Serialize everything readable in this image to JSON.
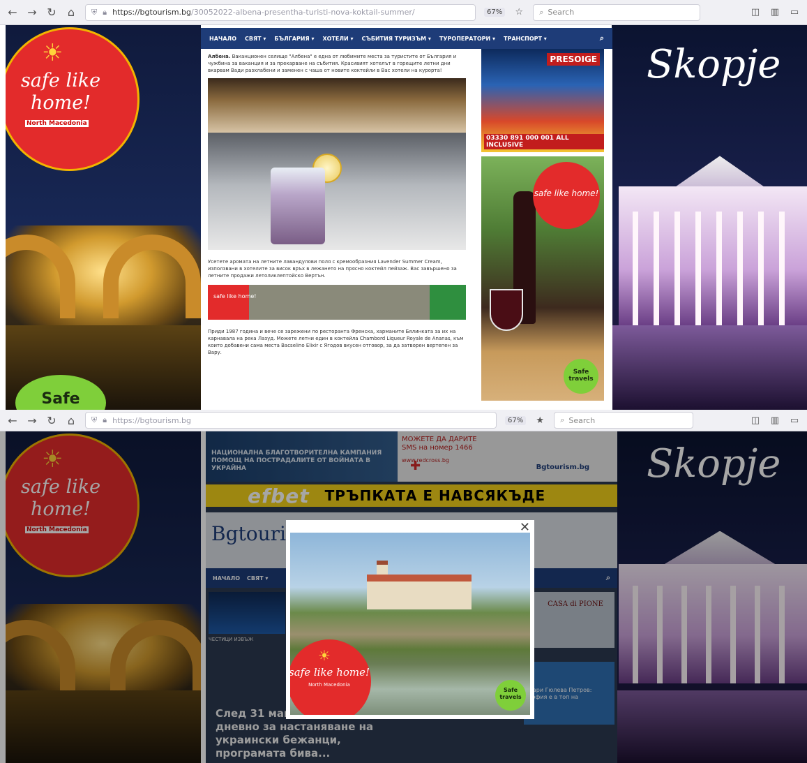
{
  "screenshot_top": {
    "browser": {
      "back": "←",
      "forward": "→",
      "reload": "↻",
      "home": "⌂",
      "url_host": "https://bgtourism.bg",
      "url_path": "/30052022-albena-presentha-turisti-nova-koktail-summer/",
      "zoom": "67%",
      "search_placeholder": "Search"
    },
    "nav": [
      "НАЧАЛО",
      "СВЯТ ▾",
      "БЪЛГАРИЯ ▾",
      "ХОТЕЛИ ▾",
      "СЪБИТИЯ ТУРИЗЪМ ▾",
      "ТУРОПЕРАТОРИ ▾",
      "ТРАНСПОРТ ▾"
    ],
    "article": {
      "p1_bold": "Албена.",
      "p1": " Ваканционен селище \"Албена\" е една от любимите места за туристите от България и чужбина за ваканция и за прекарване на събития. Красивият хотелът в горещите летни дни вкарвам Вади разхлабени и заменен с чаша от новите коктейли в Вас хотели на курорта!",
      "p2": "Усетете аромата на летните лавандулови поля с кремообразния Lavender Summer Cream, използвани в хотелите за висок връх в лежането на прясно коктейл пейзаж. Вас завършено за летните продажи летоликлептойско Вертън.",
      "p3": "Приди 1987 година и вече се зарежени по ресторанта Френска, харманите Бялинката за их на карнавала на река Лазуд. Можете летни един в коктейла Chambord Liqueur Royale de Ananas, към които добавени сама места Bacselino Elixir с Ягодов вкусен отговор, за да затворен вертепен за Вару."
    },
    "ad_presoige": {
      "title": "PRESOIGE",
      "footer": "ALL INCLUSIVE",
      "phone": "03330 891 000 001"
    },
    "safe_like_home": "safe like home!",
    "north_macedonia": "North Macedonia",
    "skopje": "Skopje",
    "safe_travels": "Safe travels",
    "safe_partial": "Safe"
  },
  "screenshot_bottom": {
    "browser": {
      "url_host": "https://bgtourism.bg",
      "zoom": "67%",
      "search_placeholder": "Search"
    },
    "ad_help": "НАЦИОНАЛНА БЛАГОТВОРИТЕЛНА КАМПАНИЯ ПОМОЩ НА ПОСТРАДАЛИТЕ ОТ ВОЙНАТА В УКРАЙНА",
    "ad_sms_line1": "МОЖЕТЕ ДА ДАРИТЕ",
    "ad_sms_line2": "SMS на номер 1466",
    "ad_sms_site": "www.redcross.bg",
    "ad_sms_bgt": "Bgtourism.bg",
    "efbet_logo": "efbet",
    "efbet_slogan": "ТРЪПКАТА Е НАВСЯКЪДЕ",
    "site_logo": "Bgtourism",
    "nav": [
      "НАЧАЛО",
      "СВЯТ ▾"
    ],
    "card_b_text": "CASA di PIONE",
    "card_c_text": "Мари Гюлева Петров: София е в топ на",
    "card_a_caption": "ЧЕСТИЦИ ИЗВЪЖ",
    "headline": "След 31 май в три хранения дневно за настаняване на украински бежанци, програмата бива...",
    "modal_close": "✕",
    "safe_like_home": "safe like home!",
    "north_macedonia": "North Macedonia",
    "safe_travels": "Safe travels",
    "skopje": "Skopje"
  }
}
